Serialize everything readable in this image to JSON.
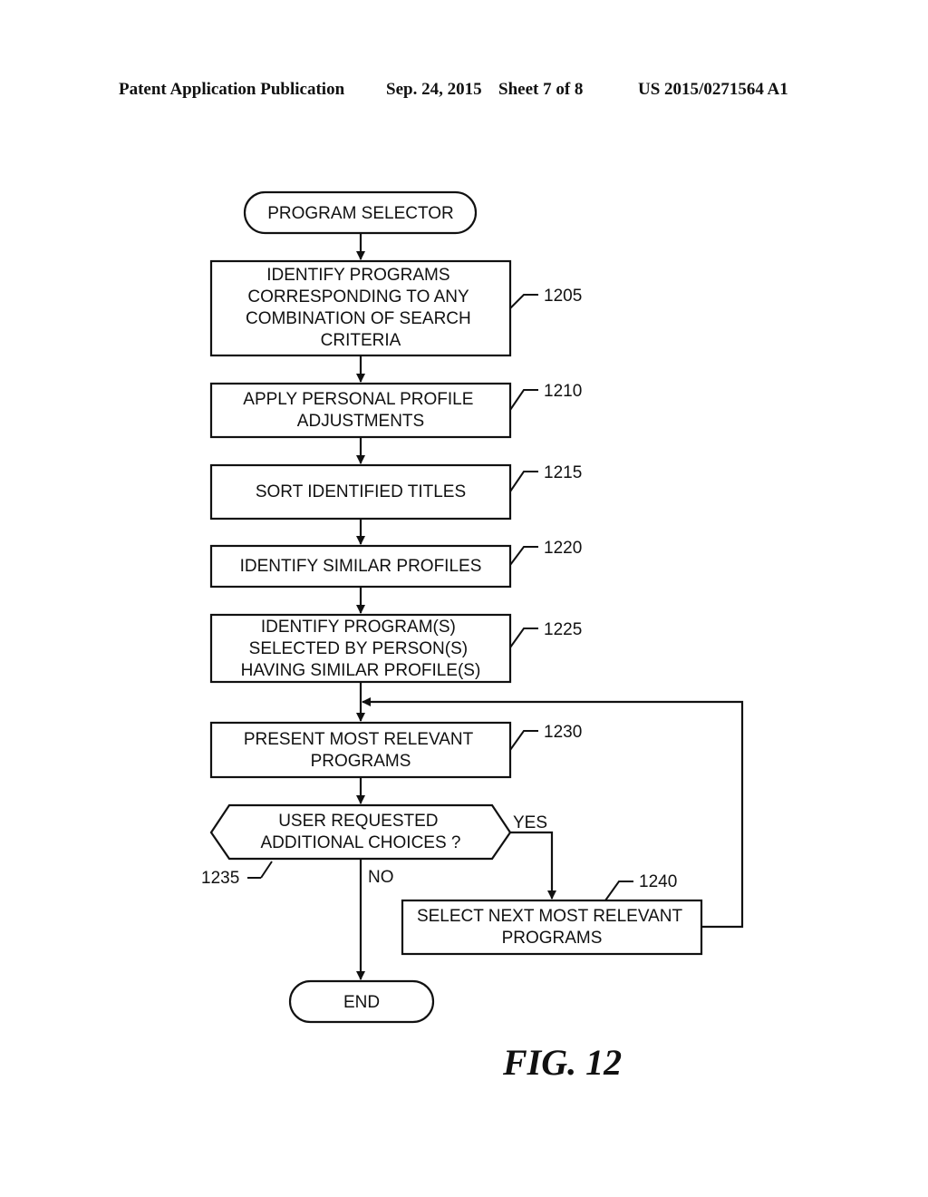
{
  "header": {
    "publication": "Patent Application Publication",
    "date": "Sep. 24, 2015",
    "sheet": "Sheet 7 of 8",
    "number": "US 2015/0271564 A1"
  },
  "figure_label": "FIG. 12",
  "flowchart": {
    "start": {
      "lines": [
        "PROGRAM SELECTOR"
      ]
    },
    "steps": [
      {
        "ref": "1205",
        "lines": [
          "IDENTIFY PROGRAMS",
          "CORRESPONDING TO ANY",
          "COMBINATION OF SEARCH",
          "CRITERIA"
        ]
      },
      {
        "ref": "1210",
        "lines": [
          "APPLY PERSONAL PROFILE",
          "ADJUSTMENTS"
        ]
      },
      {
        "ref": "1215",
        "lines": [
          "SORT IDENTIFIED TITLES"
        ]
      },
      {
        "ref": "1220",
        "lines": [
          "IDENTIFY SIMILAR PROFILES"
        ]
      },
      {
        "ref": "1225",
        "lines": [
          "IDENTIFY PROGRAM(S)",
          "SELECTED BY PERSON(S)",
          "HAVING SIMILAR PROFILE(S)"
        ]
      },
      {
        "ref": "1230",
        "lines": [
          "PRESENT MOST RELEVANT",
          "PROGRAMS"
        ]
      }
    ],
    "decision": {
      "ref": "1235",
      "lines": [
        "USER REQUESTED",
        "ADDITIONAL CHOICES ?"
      ],
      "yes_label": "YES",
      "no_label": "NO"
    },
    "loop_step": {
      "ref": "1240",
      "lines": [
        "SELECT NEXT MOST RELEVANT",
        "PROGRAMS"
      ]
    },
    "end": {
      "lines": [
        "END"
      ]
    }
  }
}
